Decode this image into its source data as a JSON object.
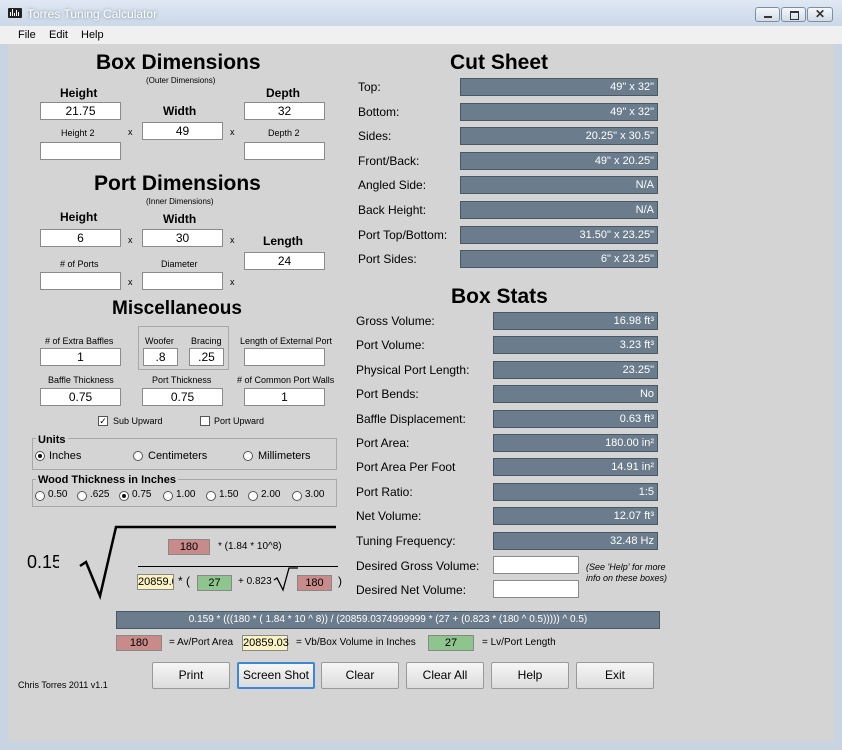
{
  "window": {
    "title": "Torres Tuning Calculator"
  },
  "menu": {
    "file": "File",
    "edit": "Edit",
    "help": "Help"
  },
  "box": {
    "title": "Box Dimensions",
    "subtitle": "(Outer Dimensions)",
    "height_label": "Height",
    "height": "21.75",
    "width_label": "Width",
    "width": "49",
    "depth_label": "Depth",
    "depth": "32",
    "height2_label": "Height 2",
    "height2": "",
    "depth2_label": "Depth 2",
    "depth2": "",
    "times": "x"
  },
  "port": {
    "title": "Port Dimensions",
    "subtitle": "(Inner Dimensions)",
    "height_label": "Height",
    "height": "6",
    "width_label": "Width",
    "width": "30",
    "length_label": "Length",
    "length": "24",
    "ports_label": "# of Ports",
    "ports": "",
    "diameter_label": "Diameter",
    "diameter": ""
  },
  "misc": {
    "title": "Miscellaneous",
    "baffles_label": "# of Extra Baffles",
    "baffles": "1",
    "woofer_label": "Woofer",
    "woofer": ".8",
    "bracing_label": "Bracing",
    "bracing": ".25",
    "ext_port_label": "Length of External Port",
    "ext_port": "",
    "baffle_thick_label": "Baffle Thickness",
    "baffle_thick": "0.75",
    "port_thick_label": "Port Thickness",
    "port_thick": "0.75",
    "common_walls_label": "# of Common Port Walls",
    "common_walls": "1",
    "sub_upward_label": "Sub Upward",
    "sub_upward": "✓",
    "port_upward_label": "Port Upward"
  },
  "units": {
    "title": "Units",
    "options": [
      "Inches",
      "Centimeters",
      "Millimeters"
    ],
    "selected": "Inches"
  },
  "wood": {
    "title": "Wood Thickness in Inches",
    "options": [
      "0.50",
      ".625",
      "0.75",
      "1.00",
      "1.50",
      "2.00",
      "3.00"
    ],
    "selected": "0.75"
  },
  "cut_sheet": {
    "title": "Cut Sheet",
    "rows": [
      {
        "label": "Top:",
        "value": "49\" x 32\""
      },
      {
        "label": "Bottom:",
        "value": "49\" x 32\""
      },
      {
        "label": "Sides:",
        "value": "20.25\" x 30.5\""
      },
      {
        "label": "Front/Back:",
        "value": "49\" x 20.25\""
      },
      {
        "label": "Angled Side:",
        "value": "N/A"
      },
      {
        "label": "Back Height:",
        "value": "N/A"
      },
      {
        "label": "Port Top/Bottom:",
        "value": "31.50\" x 23.25\""
      },
      {
        "label": "Port Sides:",
        "value": "6\" x 23.25\""
      }
    ]
  },
  "box_stats": {
    "title": "Box Stats",
    "rows": [
      {
        "label": "Gross Volume:",
        "value": "16.98 ft³"
      },
      {
        "label": "Port Volume:",
        "value": "3.23 ft³"
      },
      {
        "label": "Physical Port Length:",
        "value": "23.25\""
      },
      {
        "label": "Port Bends:",
        "value": "No"
      },
      {
        "label": "Baffle Displacement:",
        "value": "0.63 ft³"
      },
      {
        "label": "Port Area:",
        "value": "180.00 in²"
      },
      {
        "label": "Port Area Per Foot",
        "value": "14.91 in²"
      },
      {
        "label": "Port Ratio:",
        "value": "1:5"
      },
      {
        "label": "Net Volume:",
        "value": "12.07 ft³"
      },
      {
        "label": "Tuning Frequency:",
        "value": "32.48 Hz"
      }
    ],
    "desired_gross_label": "Desired Gross Volume:",
    "desired_gross": "",
    "desired_net_label": "Desired Net Volume:",
    "desired_net": "",
    "help_note": "(See 'Help' for more info on these boxes)"
  },
  "formula": {
    "coef": "0.159",
    "av": "180",
    "mult": "* (1.84 * 10^8)",
    "vb": "20859.03",
    "open": "* (",
    "lv": "27",
    "plus": "+ 0.823",
    "av2": "180",
    "close": ")",
    "expression": "0.159 * (((180 * ( 1.84 * 10 ^ 8)) / (20859.0374999999 * (27 + (0.823 * (180 ^ 0.5))))) ^ 0.5)",
    "legend": {
      "av_value": "180",
      "av_label": "= Av/Port Area",
      "vb_value": "20859.03",
      "vb_label": "= Vb/Box Volume in Inches",
      "lv_value": "27",
      "lv_label": "= Lv/Port Length"
    }
  },
  "footer": {
    "credit": "Chris Torres 2011 v1.1",
    "buttons": [
      "Print",
      "Screen Shot",
      "Clear",
      "Clear All",
      "Help",
      "Exit"
    ]
  }
}
